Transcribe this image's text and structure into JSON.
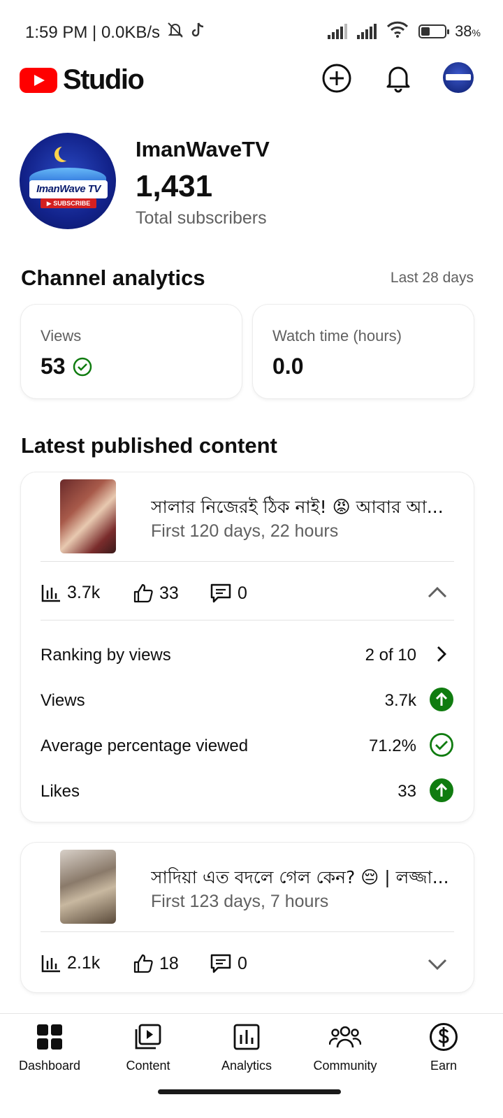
{
  "status_bar": {
    "time_and_speed": "1:59 PM | 0.0KB/s",
    "battery": "38",
    "battery_unit": "%",
    "battery_level": 0.38
  },
  "app_bar": {
    "title": "Studio"
  },
  "channel": {
    "name": "ImanWaveTV",
    "subscribers": "1,431",
    "subscribers_label": "Total subscribers",
    "avatar_text": "ImanWave TV",
    "avatar_sub_text": "▶ SUBSCRIBE"
  },
  "analytics": {
    "title": "Channel analytics",
    "range": "Last 28 days",
    "cards": [
      {
        "label": "Views",
        "value": "53",
        "icon": "check-circle-icon"
      },
      {
        "label": "Watch time (hours)",
        "value": "0.0"
      }
    ]
  },
  "latest": {
    "title": "Latest published content",
    "videos": [
      {
        "title": "সালার নিজেরই ঠিক নাই! 😡 আবার আ...",
        "meta": "First 120 days, 22 hours",
        "views": "3.7k",
        "likes": "33",
        "comments": "0",
        "expanded": true,
        "details": [
          {
            "label": "Ranking by views",
            "value": "2 of 10",
            "indicator": "chevron-right-icon"
          },
          {
            "label": "Views",
            "value": "3.7k",
            "indicator": "arrow-up-icon"
          },
          {
            "label": "Average percentage viewed",
            "value": "71.2%",
            "indicator": "check-circle-icon"
          },
          {
            "label": "Likes",
            "value": "33",
            "indicator": "arrow-up-icon"
          }
        ]
      },
      {
        "title": "সাদিয়া এত বদলে গেল কেন? 😔 | লজ্জা...",
        "meta": "First 123 days, 7 hours",
        "views": "2.1k",
        "likes": "18",
        "comments": "0",
        "expanded": false
      }
    ]
  },
  "bottom_nav": [
    {
      "label": "Dashboard",
      "icon": "dashboard-icon"
    },
    {
      "label": "Content",
      "icon": "content-icon"
    },
    {
      "label": "Analytics",
      "icon": "analytics-icon"
    },
    {
      "label": "Community",
      "icon": "community-icon"
    },
    {
      "label": "Earn",
      "icon": "earn-icon"
    }
  ],
  "colors": {
    "brand_red": "#ff0000",
    "positive_green": "#107c10",
    "secondary_text": "#606060"
  }
}
